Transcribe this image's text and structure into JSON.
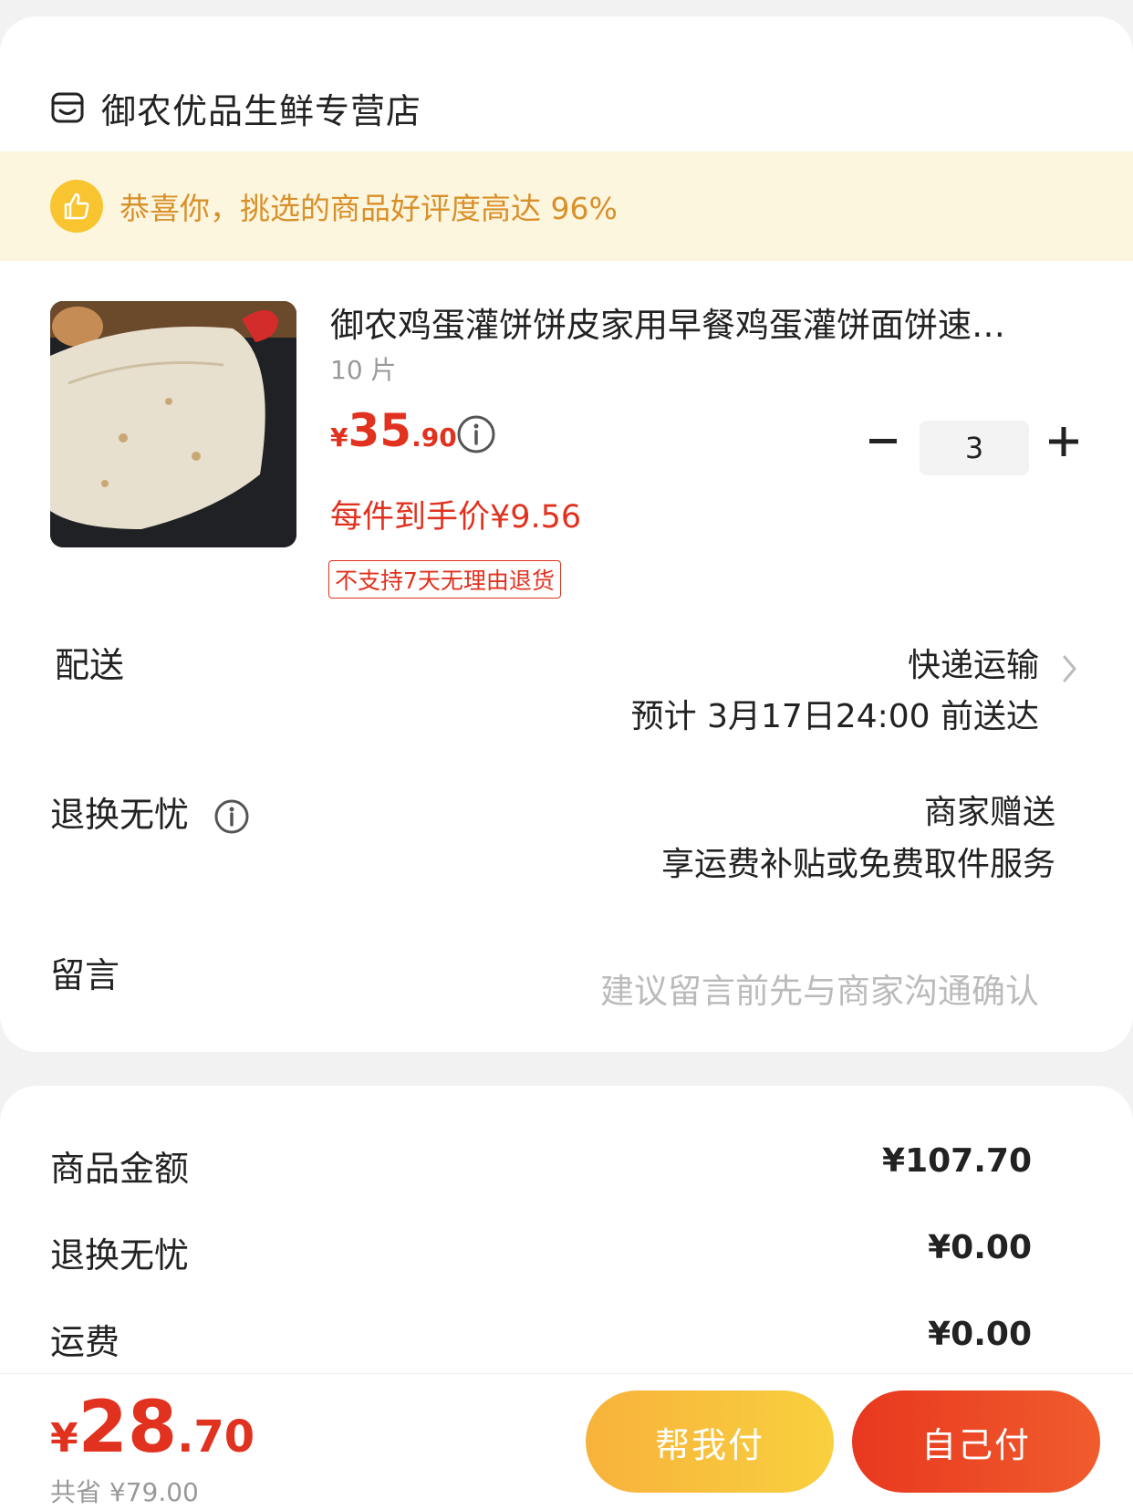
{
  "store": {
    "name": "御农优品生鲜专营店",
    "icon": "store-icon"
  },
  "banner": {
    "text": "恭喜你，挑选的商品好评度高达 96%",
    "icon": "thumbs-up-icon"
  },
  "product": {
    "title": "御农鸡蛋灌饼饼皮家用早餐鸡蛋灌饼面饼速…",
    "spec": "10 片",
    "price_currency": "¥",
    "price_int": "35",
    "price_dec": ".90",
    "each_price": "每件到手价¥9.56",
    "return_tag": "不支持7天无理由退货",
    "quantity": "3"
  },
  "delivery": {
    "label": "配送",
    "method": "快递运输",
    "eta": "预计 3月17日24:00 前送达"
  },
  "exchange": {
    "label": "退换无忧",
    "line1": "商家赠送",
    "line2": "享运费补贴或免费取件服务"
  },
  "message": {
    "label": "留言",
    "placeholder": "建议留言前先与商家沟通确认"
  },
  "summary": [
    {
      "label": "商品金额",
      "value": "¥107.70"
    },
    {
      "label": "退换无忧",
      "value": "¥0.00"
    },
    {
      "label": "运费",
      "value": "¥0.00"
    }
  ],
  "footer": {
    "total_currency": "¥",
    "total_int": "28",
    "total_dec": ".70",
    "saved": "共省 ¥79.00",
    "help_pay_label": "帮我付",
    "self_pay_label": "自己付"
  },
  "colors": {
    "accent_red": "#e0321f",
    "banner_bg": "#fdf6df",
    "banner_text": "#d8902a",
    "thumb_yellow": "#f8c531"
  }
}
